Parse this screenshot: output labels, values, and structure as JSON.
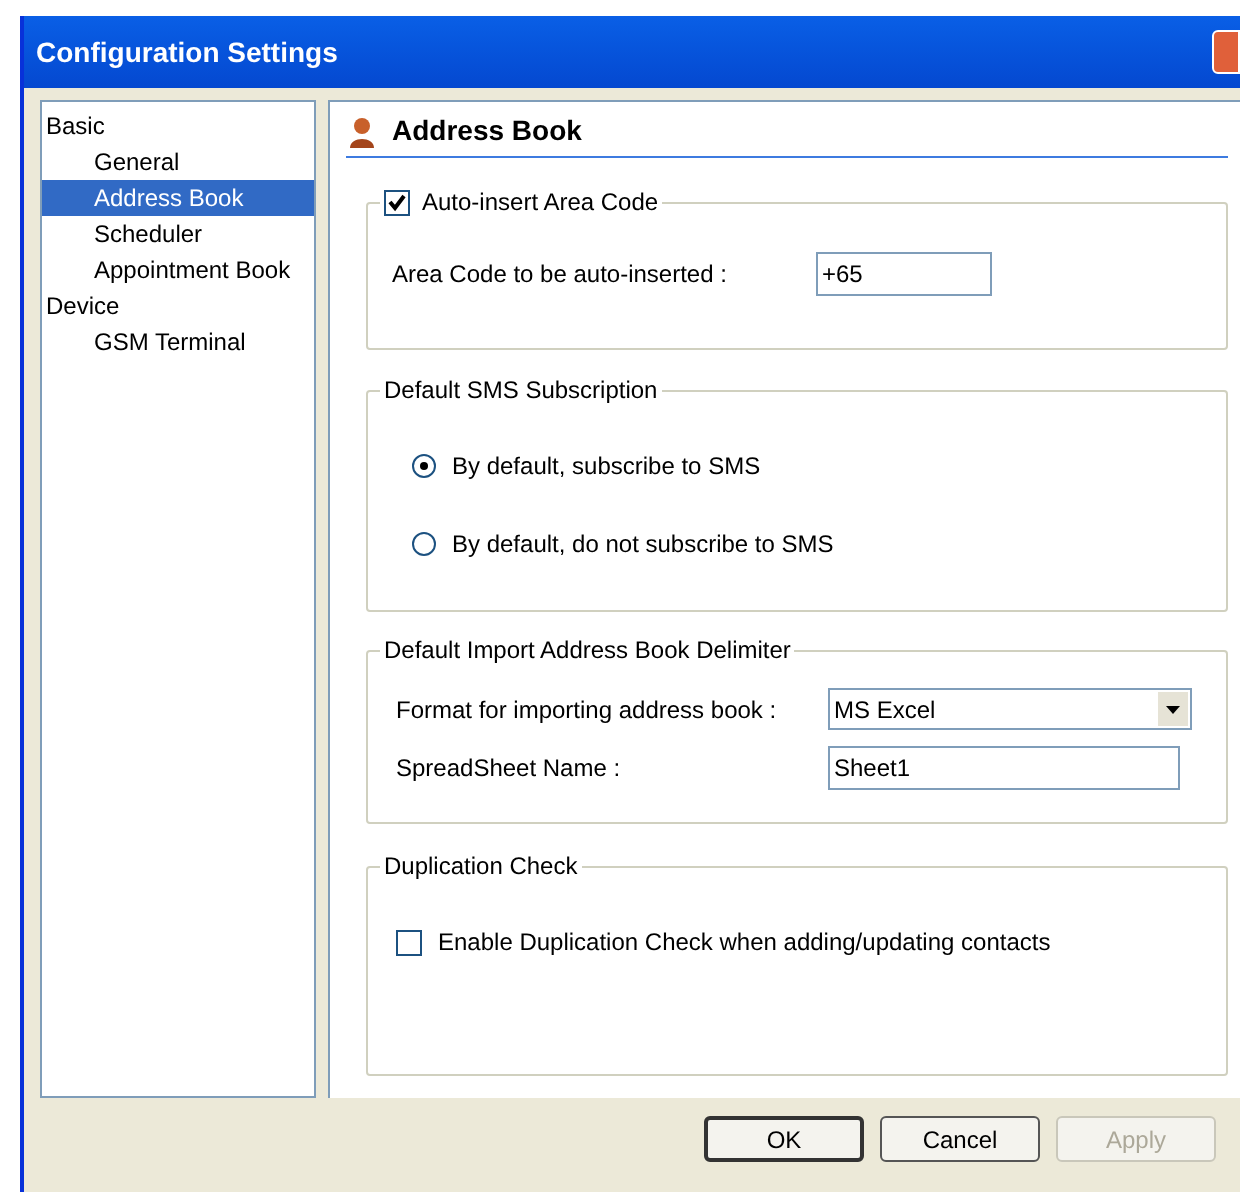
{
  "window": {
    "title": "Configuration Settings"
  },
  "tree": [
    {
      "label": "Basic",
      "selected": false,
      "children": [
        {
          "label": "General",
          "selected": false
        },
        {
          "label": "Address Book",
          "selected": true
        },
        {
          "label": "Scheduler",
          "selected": false
        },
        {
          "label": "Appointment Book",
          "selected": false
        }
      ]
    },
    {
      "label": "Device",
      "selected": false,
      "children": [
        {
          "label": "GSM Terminal",
          "selected": false
        }
      ]
    }
  ],
  "page": {
    "title": "Address Book"
  },
  "area_code": {
    "label": "Auto-insert Area Code",
    "checked": true,
    "field_label": "Area Code to be auto-inserted :",
    "value": "+65"
  },
  "sms": {
    "title": "Default SMS Subscription",
    "options": [
      {
        "label": "By default, subscribe to SMS",
        "selected": true
      },
      {
        "label": "By default, do not subscribe to SMS",
        "selected": false
      }
    ]
  },
  "delimiter": {
    "title": "Default Import Address Book Delimiter",
    "format_label": "Format for importing address book :",
    "format_value": "MS Excel",
    "sheet_label": "SpreadSheet Name :",
    "sheet_value": "Sheet1"
  },
  "duplication": {
    "title": "Duplication Check",
    "label": "Enable Duplication Check when adding/updating contacts",
    "checked": false
  },
  "buttons": [
    {
      "label": "OK",
      "disabled": false
    },
    {
      "label": "Cancel",
      "disabled": false
    },
    {
      "label": "Apply",
      "disabled": true
    }
  ]
}
